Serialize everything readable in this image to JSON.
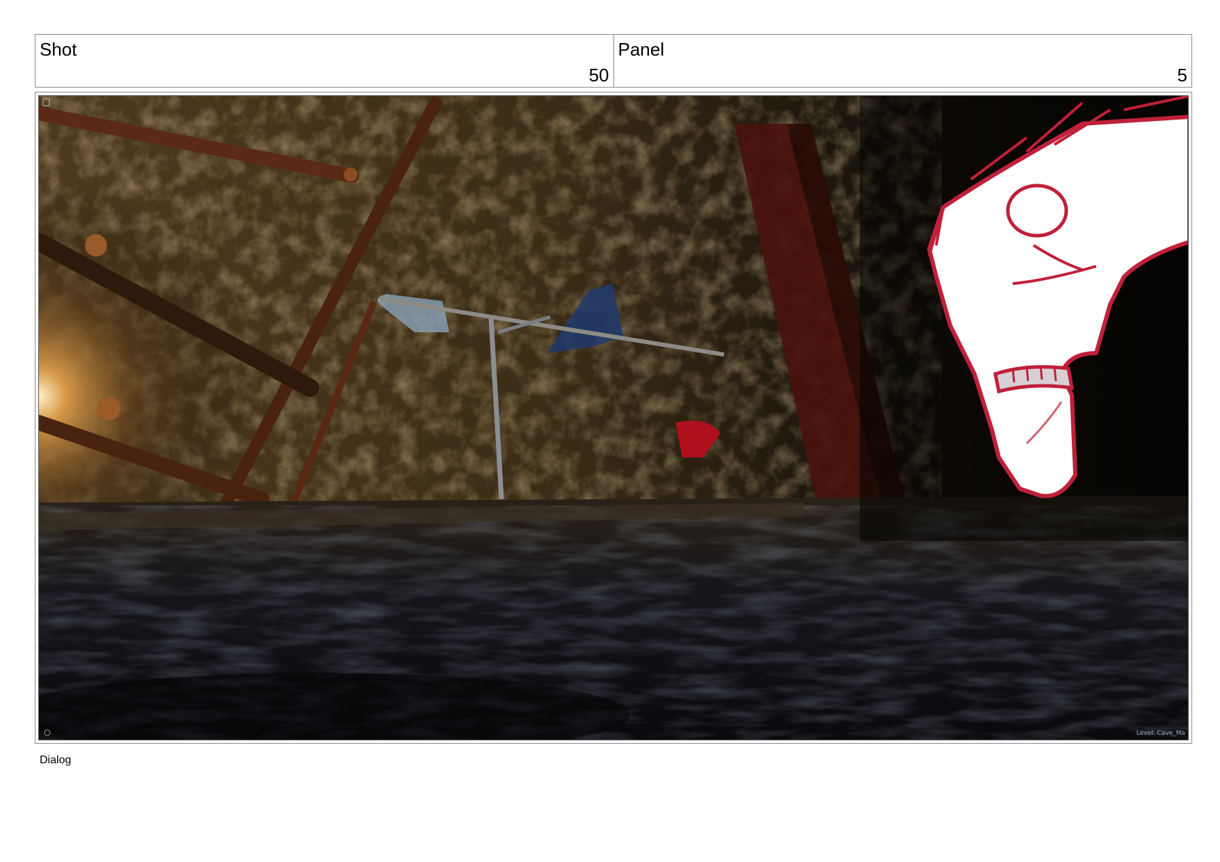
{
  "header": {
    "shot_label": "Shot",
    "shot_number": "50",
    "panel_label": "Panel",
    "panel_number": "5"
  },
  "frame": {
    "viewport_label": "Level:  Cave_Ma",
    "colors": {
      "cave_dark": "#070504",
      "rock": "#3a2c17",
      "sketch_red": "#c0203a",
      "sketch_fill": "#ffffff",
      "flag_blue": "#1f3a6e",
      "beam_red": "#4a120c"
    }
  },
  "caption": {
    "label": "Dialog"
  }
}
